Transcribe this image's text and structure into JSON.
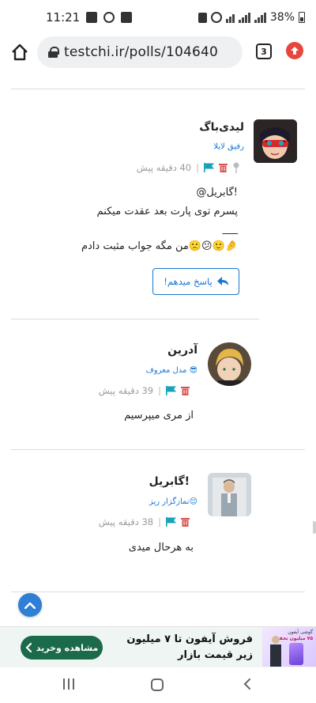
{
  "status_bar": {
    "time": "11:21",
    "battery": "38%"
  },
  "browser": {
    "url": "testchi.ir/polls/104640",
    "tab_count": "3"
  },
  "comments": [
    {
      "name": "لیدی‌باگ",
      "role": "رفیق لایلا",
      "time_ago": "40 دقیقه پیش",
      "lines": [
        "@گابریل!",
        "پسرم توی پارت بعد عقدت میکنم",
        "___",
        "من مگه جواب مثبت دادم🙁😕🙂🤌"
      ],
      "reply_label": "پاسخ میدهم!"
    },
    {
      "name": "آدرین",
      "role": "مدل معروف 😎",
      "time_ago": "39 دقیقه پیش",
      "lines": [
        "از مری میپرسیم"
      ]
    },
    {
      "name": "گابریل!",
      "role": "نمازگزار ریز😌",
      "time_ago": "38 دقیقه پیش",
      "lines": [
        "به هرحال میدی"
      ]
    }
  ],
  "ad": {
    "title": "فروش آیفون تا ۷ میلیون زیر قیمت بازار",
    "button_label": "مشاهده وخرید",
    "image_line1": "گوشی آیفون",
    "image_line2": "۷۵ میلیون تخفیف"
  },
  "colors": {
    "accent": "#1976d2",
    "trash": "#d9534f",
    "flag": "#17a2b8",
    "ad_button": "#1b6a4b"
  }
}
